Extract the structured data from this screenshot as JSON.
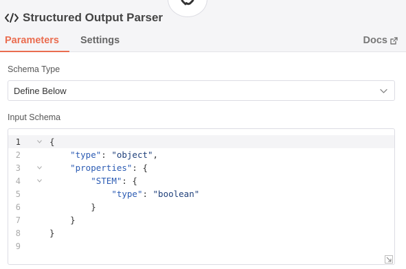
{
  "panel": {
    "title": "Structured Output Parser"
  },
  "tabs": [
    {
      "label": "Parameters",
      "active": true
    },
    {
      "label": "Settings",
      "active": false
    }
  ],
  "docs": {
    "label": "Docs"
  },
  "schema_type": {
    "label": "Schema Type",
    "value": "Define Below"
  },
  "input_schema": {
    "label": "Input Schema",
    "lines": [
      {
        "n": "1",
        "text": "{"
      },
      {
        "n": "2",
        "text": "    \"type\": \"object\","
      },
      {
        "n": "3",
        "text": "    \"properties\": {"
      },
      {
        "n": "4",
        "text": "        \"STEM\": {"
      },
      {
        "n": "5",
        "text": "            \"type\": \"boolean\""
      },
      {
        "n": "6",
        "text": "        }"
      },
      {
        "n": "7",
        "text": "    }"
      },
      {
        "n": "8",
        "text": "}"
      },
      {
        "n": "9",
        "text": ""
      }
    ]
  },
  "colors": {
    "accent": "#ea6d50",
    "json_key": "#2b5bb3",
    "json_string": "#1e3f7a"
  },
  "icons": {
    "title": "code-icon",
    "node": "chain-link-icon",
    "docs": "external-link-icon",
    "select": "chevron-down-icon"
  }
}
